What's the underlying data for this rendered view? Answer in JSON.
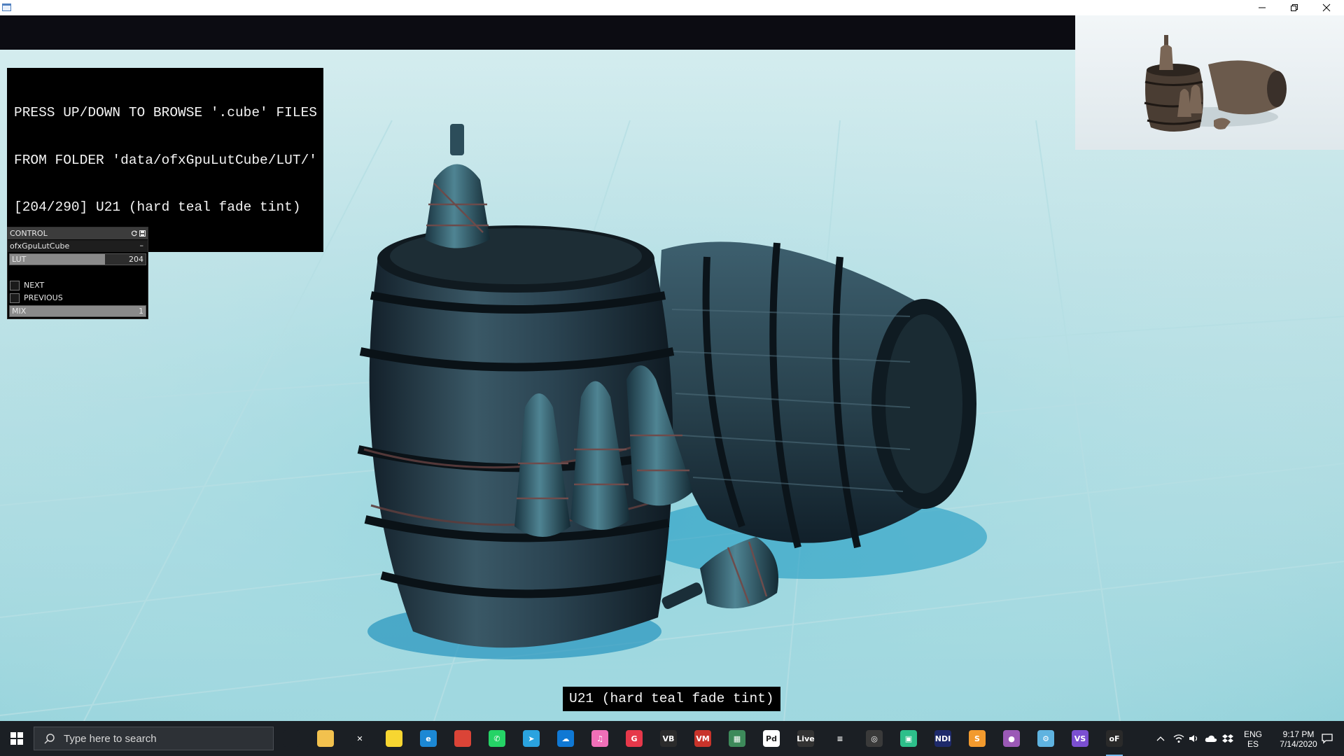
{
  "window": {
    "title": "",
    "controls": [
      "minimize",
      "restore",
      "close"
    ]
  },
  "overlay": {
    "line1": "PRESS UP/DOWN TO BROWSE '.cube' FILES",
    "line2": "FROM FOLDER 'data/ofxGpuLutCube/LUT/'",
    "line3": "[204/290] U21 (hard teal fade tint)"
  },
  "panel": {
    "title": "CONTROL",
    "group": "ofxGpuLutCube",
    "group_toggle": "–",
    "lut": {
      "label": "LUT",
      "value": "204",
      "fraction": 0.7034
    },
    "next_label": "NEXT",
    "previous_label": "PREVIOUS",
    "mix": {
      "label": "MIX",
      "value": "1",
      "fraction": 1.0
    }
  },
  "caption": "U21 (hard teal fade tint)",
  "taskbar": {
    "search_placeholder": "Type here to search",
    "apps": [
      {
        "name": "task-view",
        "glyph": "",
        "color": "#1b1f24"
      },
      {
        "name": "file-explorer",
        "glyph": "",
        "color": "#f2c14e"
      },
      {
        "name": "xampp",
        "glyph": "✕",
        "color": "#1b1f24"
      },
      {
        "name": "sticky-notes",
        "glyph": "",
        "color": "#f7d631"
      },
      {
        "name": "edge",
        "glyph": "e",
        "color": "#1c88d4"
      },
      {
        "name": "chrome",
        "glyph": "",
        "color": "#db4437"
      },
      {
        "name": "whatsapp",
        "glyph": "✆",
        "color": "#25d366"
      },
      {
        "name": "telegram",
        "glyph": "➤",
        "color": "#2aa3df"
      },
      {
        "name": "onedrive",
        "glyph": "☁",
        "color": "#0f78d4"
      },
      {
        "name": "itunes",
        "glyph": "♫",
        "color": "#f06fb8"
      },
      {
        "name": "grammarly",
        "glyph": "G",
        "color": "#e6384a"
      },
      {
        "name": "vb-audio",
        "glyph": "VB",
        "color": "#2b2b2b"
      },
      {
        "name": "voicemeeter",
        "glyph": "VM",
        "color": "#c8342b"
      },
      {
        "name": "synth-app",
        "glyph": "▦",
        "color": "#3d8a5a"
      },
      {
        "name": "pd",
        "glyph": "Pd",
        "color": "#ffffff"
      },
      {
        "name": "ableton-live",
        "glyph": "Live",
        "color": "#333333"
      },
      {
        "name": "menu-app",
        "glyph": "≡",
        "color": "#1b1f24"
      },
      {
        "name": "obs",
        "glyph": "◎",
        "color": "#3a3a3a"
      },
      {
        "name": "game-app",
        "glyph": "▣",
        "color": "#2dbf8a"
      },
      {
        "name": "ndi",
        "glyph": "NDI",
        "color": "#1e2a6b"
      },
      {
        "name": "sublime",
        "glyph": "S",
        "color": "#f29a2e"
      },
      {
        "name": "discord-app",
        "glyph": "●",
        "color": "#9b59b6"
      },
      {
        "name": "settings-app",
        "glyph": "⚙",
        "color": "#5fb3e0"
      },
      {
        "name": "visual-studio",
        "glyph": "VS",
        "color": "#7b4fd1"
      },
      {
        "name": "openframeworks",
        "glyph": "oF",
        "color": "#2a2a2a"
      }
    ],
    "lang_line1": "ENG",
    "lang_line2": "ES",
    "time": "9:17 PM",
    "date": "7/14/2020"
  },
  "colors": {
    "accent": "#76b9ed",
    "scene_floor": "#a6d8de",
    "barrel_dark": "#1f2f3a"
  }
}
